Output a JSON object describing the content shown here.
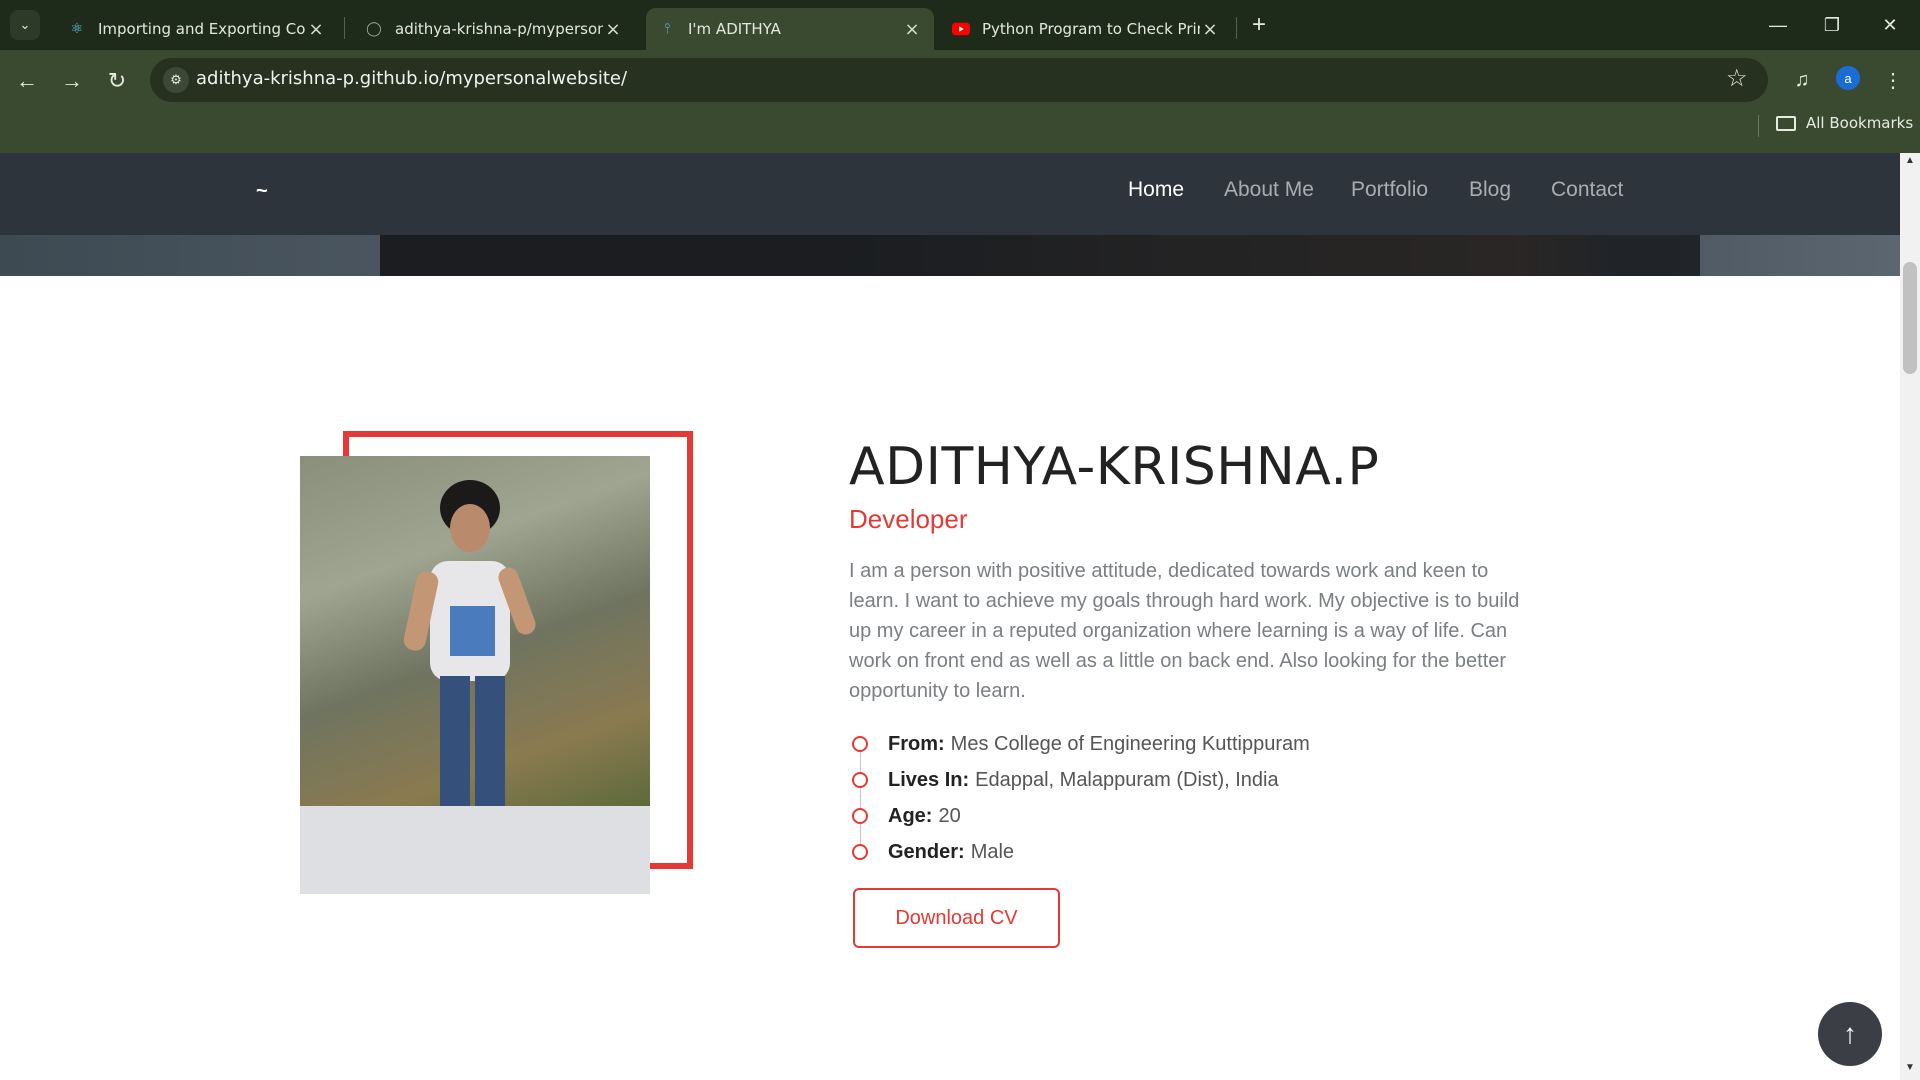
{
  "browser": {
    "tabs": [
      {
        "title": "Importing and Exporting Comp",
        "icon": "react-icon"
      },
      {
        "title": "adithya-krishna-p/mypersonalw",
        "icon": "github-icon"
      },
      {
        "title": "I'm ADITHYA",
        "icon": "site-icon",
        "active": true
      },
      {
        "title": "Python Program to Check Prim",
        "icon": "youtube-icon"
      }
    ],
    "url": "adithya-krishna-p.github.io/mypersonalwebsite/",
    "bookmarks_label": "All Bookmarks",
    "avatar_letter": "a"
  },
  "site": {
    "brand": "~",
    "nav": [
      "Home",
      "About Me",
      "Portfolio",
      "Blog",
      "Contact"
    ],
    "active_nav": "Home"
  },
  "profile": {
    "name": "ADITHYA-KRISHNA.P",
    "role": "Developer",
    "about": "I am a person with positive attitude, dedicated towards work and keen to learn. I want to achieve my goals through hard work. My objective is to build up my career in a reputed organization where learning is a way of life. Can work on front end as well as a little on back end. Also looking for the better opportunity to learn.",
    "facts": [
      {
        "key": "From:",
        "value": "Mes College of Engineering Kuttippuram"
      },
      {
        "key": "Lives In:",
        "value": "Edappal, Malappuram (Dist), India"
      },
      {
        "key": "Age:",
        "value": "20"
      },
      {
        "key": "Gender:",
        "value": "Male"
      }
    ],
    "cv_label": "Download CV"
  },
  "colors": {
    "accent": "#e53935",
    "nav_bg": "#2e343b",
    "chrome_bg": "#3a4a30"
  }
}
